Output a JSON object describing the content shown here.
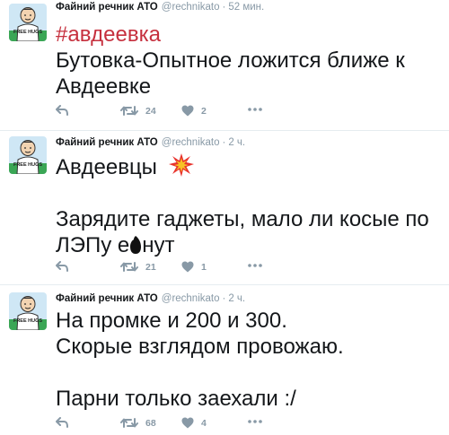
{
  "tweets": [
    {
      "author_name": "Файний речник АТО",
      "handle": "@rechnikato",
      "separator": "·",
      "time": "52 мин.",
      "hashtag": "#авдеевка",
      "lines": [
        "Бутовка-Опытное ложится ближе к",
        "Авдеевке"
      ],
      "retweets": "24",
      "likes": "2"
    },
    {
      "author_name": "Файний речник АТО",
      "handle": "@rechnikato",
      "separator": "·",
      "time": "2 ч.",
      "lines": [
        "Авдеевцы",
        "",
        "Зарядите гаджеты, мало ли косые по",
        "ЛЭПу е",
        "нут"
      ],
      "retweets": "21",
      "likes": "1"
    },
    {
      "author_name": "Файний речник АТО",
      "handle": "@rechnikato",
      "separator": "·",
      "time": "2 ч.",
      "lines": [
        "На промке и 200 и 300.",
        "Скорые взглядом провожаю.",
        "",
        "Парни только заехали :/"
      ],
      "retweets": "68",
      "likes": "4"
    }
  ],
  "avatar_text": "FREE HUGS",
  "icons": {
    "reply": "reply-icon",
    "retweet": "retweet-icon",
    "like": "heart-icon",
    "more": "more-dots-icon",
    "emoji": "collision-emoji-icon",
    "censor": "censor-blot-icon"
  },
  "colors": {
    "hashtag": "#c6303e",
    "meta": "#8899a6",
    "text": "#14171a",
    "avatar_green": "#3aa655",
    "avatar_sky": "#cfe7f5"
  }
}
